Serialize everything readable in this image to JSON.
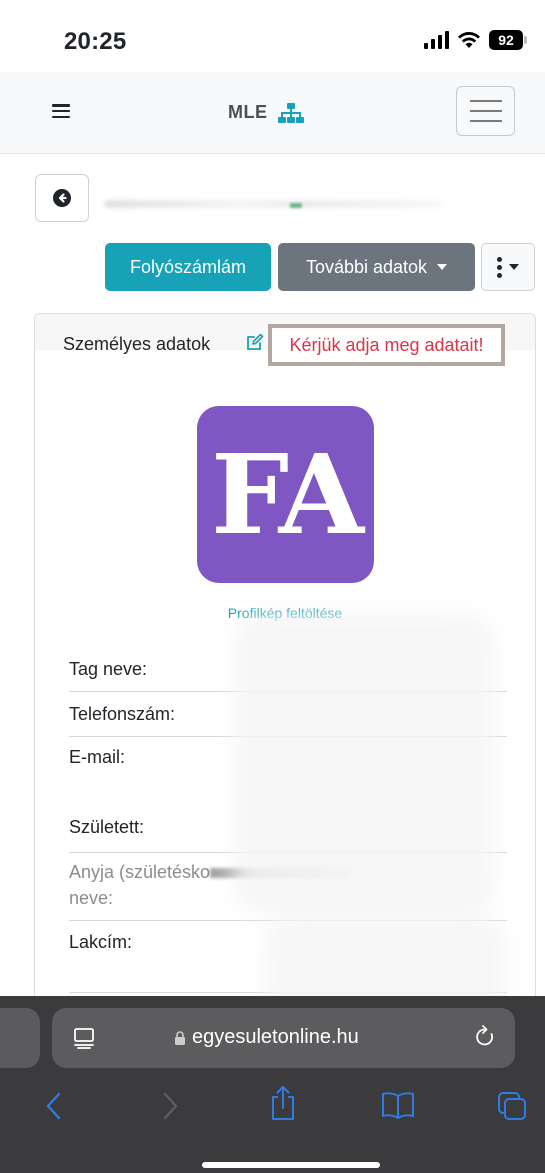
{
  "status_bar": {
    "time": "20:25",
    "battery": "92"
  },
  "navbar": {
    "brand": "MLE"
  },
  "actions": {
    "account_button": "Folyószámlám",
    "more_data_button": "További adatok"
  },
  "card": {
    "title": "Személyes adatok",
    "warning": "Kérjük adja meg adatait!",
    "avatar_initials": "FA",
    "upload_link": "Profilkép feltöltése",
    "fields": {
      "member_name": "Tag neve:",
      "phone": "Telefonszám:",
      "email": "E-mail:",
      "born": "Született:",
      "mother_name_line1": "Anyja (születésko",
      "mother_name_line2": "neve:",
      "address": "Lakcím:"
    }
  },
  "browser": {
    "url": "egyesuletonline.hu"
  },
  "colors": {
    "accent_teal": "#17a2b8",
    "secondary_gray": "#6c757d",
    "avatar_purple": "#7e57c2",
    "warning_red": "#dc3545"
  }
}
